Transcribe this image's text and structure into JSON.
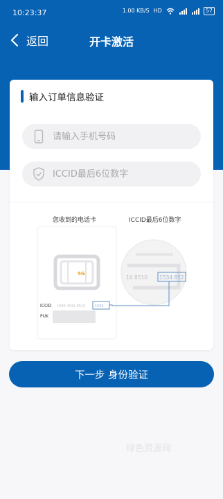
{
  "status_bar": {
    "time": "10:23:37",
    "net_speed": "1.00 KB/S",
    "hd": "HD",
    "battery": "57"
  },
  "header": {
    "back_label": "返回",
    "title": "开卡激活"
  },
  "form": {
    "section_title": "输入订单信息验证",
    "phone_placeholder": "请输入手机号码",
    "iccid_placeholder": "ICCID最后6位数字"
  },
  "illustration": {
    "left_caption": "您收到的电话卡",
    "right_caption": "ICCID最后6位数字",
    "sim_badge": "5G",
    "iccid_label": "ICCID",
    "iccid_digits": "1986 4319 8510",
    "iccid_last": "1534",
    "puk_label": "PUK",
    "zoom_digits": "16 8510",
    "zoom_last": "1534 852"
  },
  "actions": {
    "next_label": "下一步 身份验证"
  },
  "watermark": "绿色资源网",
  "colors": {
    "brand_blue": "#0762b4",
    "page_bg": "#f7f7f9"
  }
}
